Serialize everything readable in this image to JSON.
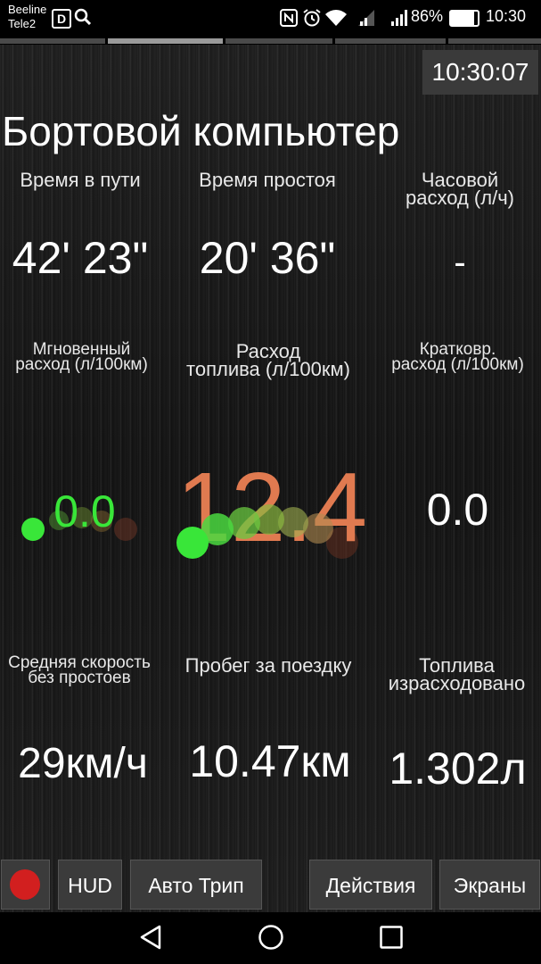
{
  "status_bar": {
    "carrier1": "Beeline",
    "carrier2": "Tele2",
    "battery": "86%",
    "time": "10:30"
  },
  "header": {
    "clock": "10:30:07",
    "title": "Бортовой компьютер"
  },
  "metrics": {
    "travel_time": {
      "label": "Время в пути",
      "value": "42' 23\""
    },
    "idle_time": {
      "label": "Время простоя",
      "value": "20' 36\""
    },
    "hourly_consumption": {
      "label_line1": "Часовой",
      "label_line2": "расход (л/ч)",
      "value": "-"
    },
    "instant_consumption": {
      "label_line1": "Мгновенный",
      "label_line2": "расход (л/100км)",
      "value": "0.0"
    },
    "fuel_consumption": {
      "label_line1": "Расход",
      "label_line2": "топлива (л/100км)",
      "value": "12.4"
    },
    "short_term_consumption": {
      "label_line1": "Кратковр.",
      "label_line2": "расход (л/100км)",
      "value": "0.0"
    },
    "avg_speed": {
      "label_line1": "Средняя скорость",
      "label_line2": "без простоев",
      "value": "29км/ч"
    },
    "trip_distance": {
      "label": "Пробег за поездку",
      "value": "10.47км"
    },
    "fuel_used": {
      "label_line1": "Топлива",
      "label_line2": "израсходовано",
      "value": "1.302л"
    }
  },
  "toolbar": {
    "hud_label": "HUD",
    "auto_trip_label": "Авто Трип",
    "actions_label": "Действия",
    "screens_label": "Экраны"
  },
  "colors": {
    "green": "#39e639",
    "orange": "#e07a50",
    "record": "#d21f1f"
  }
}
